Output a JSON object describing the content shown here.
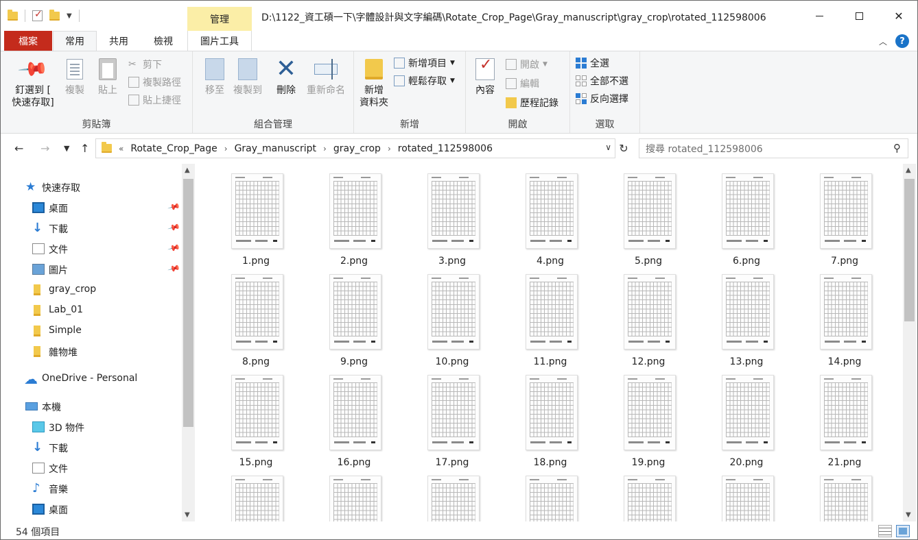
{
  "titlebar": {
    "manage_tab": "管理",
    "path": "D:\\1122_資工碩一下\\字體設計與文字編碼\\Rotate_Crop_Page\\Gray_manuscript\\gray_crop\\rotated_112598006",
    "minimize": "",
    "maximize": "",
    "close": "✕"
  },
  "tabs": {
    "file": "檔案",
    "home": "常用",
    "share": "共用",
    "view": "檢視",
    "picture_tools": "圖片工具"
  },
  "ribbon": {
    "clipboard": {
      "label": "剪貼簿",
      "pin_line1": "釘選到 [",
      "pin_line2": "快速存取]",
      "copy": "複製",
      "paste": "貼上",
      "cut": "剪下",
      "copy_path": "複製路徑",
      "paste_shortcut": "貼上捷徑"
    },
    "organize": {
      "label": "組合管理",
      "move_to": "移至",
      "copy_to": "複製到",
      "delete": "刪除",
      "rename": "重新命名"
    },
    "new": {
      "label": "新增",
      "new_folder_line1": "新增",
      "new_folder_line2": "資料夾",
      "new_item": "新增項目",
      "easy_access": "輕鬆存取"
    },
    "open": {
      "label": "開啟",
      "properties": "內容",
      "open": "開啟",
      "edit": "編輯",
      "history": "歷程記錄"
    },
    "select": {
      "label": "選取",
      "select_all": "全選",
      "select_none": "全部不選",
      "invert": "反向選擇"
    }
  },
  "address": {
    "overflow": "«",
    "crumbs": [
      "Rotate_Crop_Page",
      "Gray_manuscript",
      "gray_crop",
      "rotated_112598006"
    ],
    "search_placeholder": "搜尋 rotated_112598006"
  },
  "sidebar": {
    "items": [
      {
        "label": "快速存取",
        "icon": "star-icon"
      },
      {
        "label": "桌面",
        "icon": "desktop-icon"
      },
      {
        "label": "下載",
        "icon": "download-icon"
      },
      {
        "label": "文件",
        "icon": "document-icon"
      },
      {
        "label": "圖片",
        "icon": "pictures-icon"
      },
      {
        "label": "gray_crop",
        "icon": "folder-icon"
      },
      {
        "label": "Lab_01",
        "icon": "folder-icon"
      },
      {
        "label": "Simple",
        "icon": "folder-icon"
      },
      {
        "label": "雜物堆",
        "icon": "folder-icon"
      },
      {
        "label": "OneDrive - Personal",
        "icon": "cloud-icon"
      },
      {
        "label": "本機",
        "icon": "computer-icon"
      },
      {
        "label": "3D 物件",
        "icon": "3d-objects-icon"
      },
      {
        "label": "下載",
        "icon": "download-icon"
      },
      {
        "label": "文件",
        "icon": "document-icon"
      },
      {
        "label": "音樂",
        "icon": "music-icon"
      },
      {
        "label": "桌面",
        "icon": "desktop-icon"
      }
    ]
  },
  "files": [
    "1.png",
    "2.png",
    "3.png",
    "4.png",
    "5.png",
    "6.png",
    "7.png",
    "8.png",
    "9.png",
    "10.png",
    "11.png",
    "12.png",
    "13.png",
    "14.png",
    "15.png",
    "16.png",
    "17.png",
    "18.png",
    "19.png",
    "20.png",
    "21.png",
    "",
    "",
    "",
    "",
    "",
    "",
    ""
  ],
  "status": {
    "count": "54 個項目"
  }
}
